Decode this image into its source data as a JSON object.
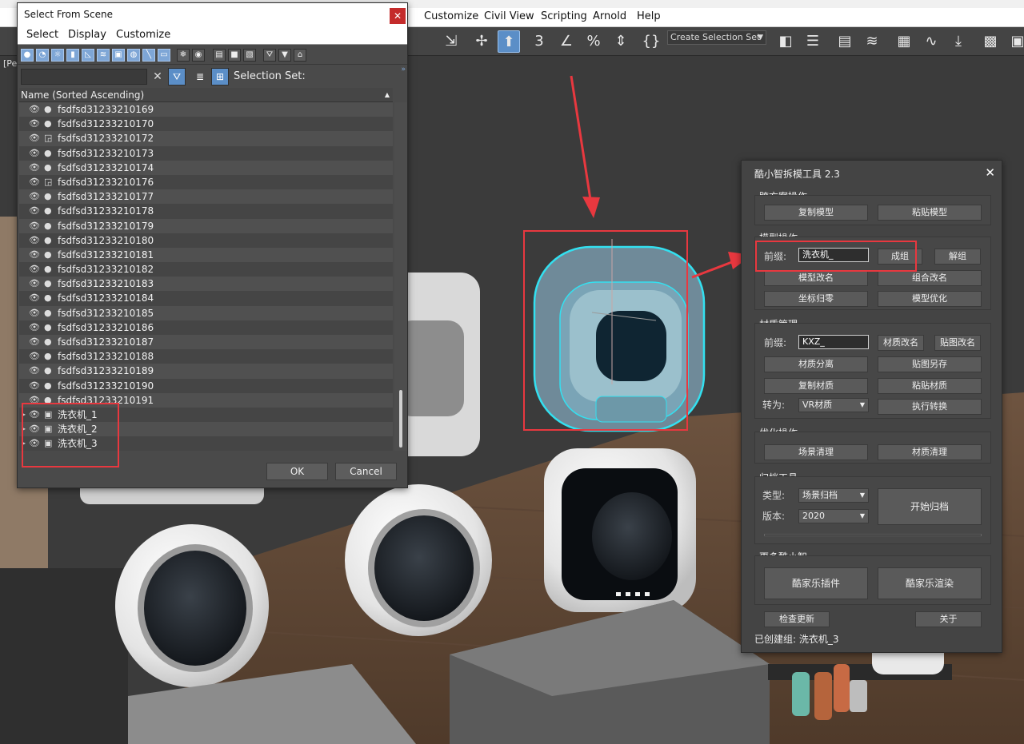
{
  "app": {
    "menu": [
      "Customize",
      "Civil View",
      "Scripting",
      "Arnold",
      "Help"
    ],
    "selection_set_combo": "Create Selection Set",
    "viewport_label": "[Pe"
  },
  "dialog": {
    "title": "Select From Scene",
    "close": "✕",
    "menu": [
      "Select",
      "Display",
      "Customize"
    ],
    "selection_set_label": "Selection Set:",
    "column_header": "Name (Sorted Ascending)",
    "rows": [
      {
        "name": "fsdfsd31233210169",
        "icon": "sphere"
      },
      {
        "name": "fsdfsd31233210170",
        "icon": "sphere"
      },
      {
        "name": "fsdfsd31233210172",
        "icon": "instance"
      },
      {
        "name": "fsdfsd31233210173",
        "icon": "sphere"
      },
      {
        "name": "fsdfsd31233210174",
        "icon": "sphere"
      },
      {
        "name": "fsdfsd31233210176",
        "icon": "instance"
      },
      {
        "name": "fsdfsd31233210177",
        "icon": "sphere"
      },
      {
        "name": "fsdfsd31233210178",
        "icon": "sphere"
      },
      {
        "name": "fsdfsd31233210179",
        "icon": "sphere"
      },
      {
        "name": "fsdfsd31233210180",
        "icon": "sphere"
      },
      {
        "name": "fsdfsd31233210181",
        "icon": "sphere"
      },
      {
        "name": "fsdfsd31233210182",
        "icon": "sphere"
      },
      {
        "name": "fsdfsd31233210183",
        "icon": "sphere"
      },
      {
        "name": "fsdfsd31233210184",
        "icon": "sphere"
      },
      {
        "name": "fsdfsd31233210185",
        "icon": "sphere"
      },
      {
        "name": "fsdfsd31233210186",
        "icon": "sphere"
      },
      {
        "name": "fsdfsd31233210187",
        "icon": "sphere"
      },
      {
        "name": "fsdfsd31233210188",
        "icon": "sphere"
      },
      {
        "name": "fsdfsd31233210189",
        "icon": "sphere"
      },
      {
        "name": "fsdfsd31233210190",
        "icon": "sphere"
      },
      {
        "name": "fsdfsd31233210191",
        "icon": "sphere"
      },
      {
        "name": "洗衣机_1",
        "icon": "group"
      },
      {
        "name": "洗衣机_2",
        "icon": "group"
      },
      {
        "name": "洗衣机_3",
        "icon": "group"
      }
    ],
    "ok": "OK",
    "cancel": "Cancel"
  },
  "tool": {
    "title": "酷小智拆模工具 2.3",
    "close": "✕",
    "cross": {
      "title": "跨方案操作",
      "copy": "复制模型",
      "paste": "粘贴模型"
    },
    "model": {
      "title": "模型操作",
      "prefix_label": "前缀:",
      "prefix_value": "洗衣机_",
      "group": "成组",
      "ungroup": "解组",
      "rename": "模型改名",
      "group_rename": "组合改名",
      "zero": "坐标归零",
      "optimize": "模型优化"
    },
    "material": {
      "title": "材质管理",
      "prefix_label": "前缀:",
      "prefix_value": "KXZ_",
      "rename": "材质改名",
      "map_rename": "贴图改名",
      "separate": "材质分离",
      "save_maps": "贴图另存",
      "copy": "复制材质",
      "paste": "粘贴材质",
      "convert_label": "转为:",
      "convert_value": "VR材质",
      "run_convert": "执行转换"
    },
    "optimize": {
      "title": "优化操作",
      "scene_clean": "场景清理",
      "mat_clean": "材质清理"
    },
    "archive": {
      "title": "归档工具",
      "type_label": "类型:",
      "type_value": "场景归档",
      "version_label": "版本:",
      "version_value": "2020",
      "start": "开始归档"
    },
    "more": {
      "title": "更多酷小智",
      "plugin": "酷家乐插件",
      "render": "酷家乐渲染"
    },
    "check_update": "检查更新",
    "about": "关于",
    "status": "已创建组: 洗衣机_3"
  },
  "colors": {
    "accent": "#5b8ec7",
    "annotation": "#e8383f",
    "selection_cyan": "#33e0f0"
  }
}
